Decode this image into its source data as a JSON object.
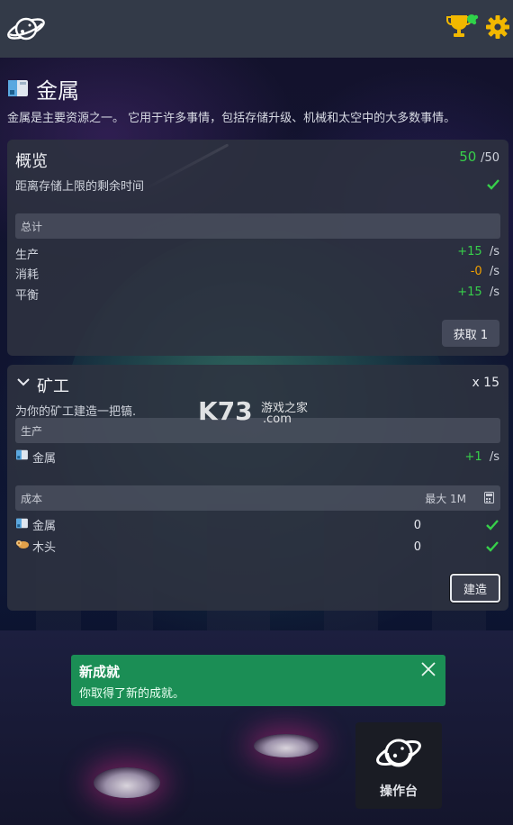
{
  "resource": {
    "title": "金属",
    "description": "金属是主要资源之一。 它用于许多事情，包括存储升级、机械和太空中的大多数事情。"
  },
  "overview": {
    "title": "概览",
    "amount": "50",
    "capacity": "/50",
    "time_to_full_label": "距离存储上限的剩余时间",
    "total_label": "总计",
    "rows": [
      {
        "label": "生产",
        "value": "+15",
        "unit": "/s",
        "tone": "positive"
      },
      {
        "label": "消耗",
        "value": "-0",
        "unit": "/s",
        "tone": "warning"
      },
      {
        "label": "平衡",
        "value": "+15",
        "unit": "/s",
        "tone": "positive"
      }
    ],
    "obtain_button": "获取 1"
  },
  "miner": {
    "title": "矿工",
    "count": "x 15",
    "description": "为你的矿工建造一把镐.",
    "production_label": "生产",
    "production": [
      {
        "icon": "metal-icon",
        "label": "金属",
        "value": "+1",
        "unit": "/s"
      }
    ],
    "cost_label": "成本",
    "max_label": "最大 1M",
    "costs": [
      {
        "icon": "metal-icon",
        "label": "金属",
        "value": "0"
      },
      {
        "icon": "wood-icon",
        "label": "木头",
        "value": "0"
      }
    ],
    "build_button": "建造"
  },
  "toast": {
    "title": "新成就",
    "message": "你取得了新的成就。"
  },
  "console": {
    "label": "操作台"
  },
  "watermark": {
    "brand": "K73",
    "site_name": "游戏之家",
    "domain": ".com"
  },
  "colors": {
    "positive": "#37d04a",
    "warning": "#f0a000",
    "toast_bg": "#1b8e55",
    "topbar_bg": "#333a48",
    "panel_bg": "#2e3240"
  }
}
